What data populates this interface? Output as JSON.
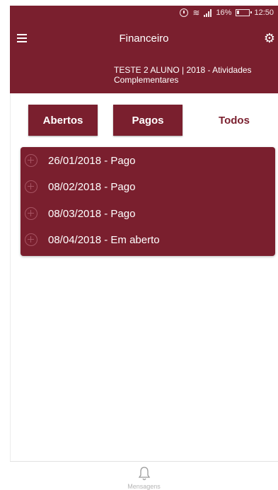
{
  "status_bar": {
    "battery_percent": "16%",
    "time": "12:50"
  },
  "app_bar": {
    "title": "Financeiro"
  },
  "header": {
    "subtitle": "TESTE 2 ALUNO  | 2018 - Atividades Complementares"
  },
  "tabs": [
    {
      "label": "Abertos"
    },
    {
      "label": "Pagos"
    },
    {
      "label": "Todos"
    }
  ],
  "items": [
    {
      "label": "26/01/2018 - Pago"
    },
    {
      "label": "08/02/2018 - Pago"
    },
    {
      "label": "08/03/2018 - Pago"
    },
    {
      "label": "08/04/2018 - Em aberto"
    }
  ],
  "bottom_nav": {
    "label": "Mensagens"
  },
  "colors": {
    "primary": "#7a1f2e",
    "on_primary": "#ffffff",
    "muted_icon": "#a65362"
  },
  "icons": {
    "menu": "menu-icon",
    "settings": "gear-icon",
    "expand": "plus-circle-icon",
    "messages": "bell-icon"
  }
}
